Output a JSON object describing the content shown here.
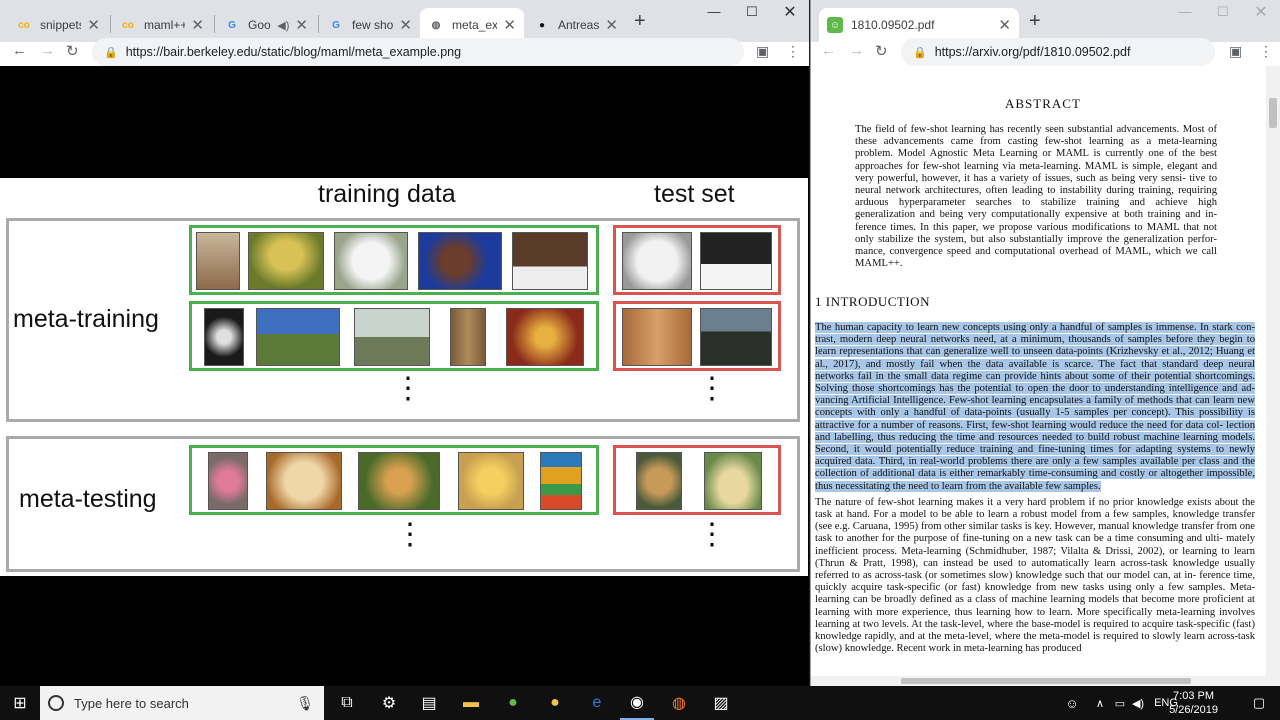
{
  "left_window": {
    "tabs": [
      {
        "title": "snippets.ip",
        "favicon": "colab-icon"
      },
      {
        "title": "maml++.ip",
        "favicon": "colab-icon"
      },
      {
        "title": "Googl",
        "favicon": "google-docs-icon"
      },
      {
        "title": "few shot le",
        "favicon": "google-icon"
      },
      {
        "title": "meta_exam",
        "favicon": "globe-icon"
      },
      {
        "title": "AntreasAnt",
        "favicon": "github-icon"
      }
    ],
    "url": "https://bair.berkeley.edu/static/blog/maml/meta_example.png",
    "figure": {
      "header_train": "training data",
      "header_test": "test set",
      "row1_label": "meta-training",
      "row2_label": "meta-testing",
      "dots": "⋮"
    }
  },
  "right_window": {
    "tab_title": "1810.09502.pdf",
    "url": "https://arxiv.org/pdf/1810.09502.pdf",
    "abstract_title": "ABSTRACT",
    "abstract_lines": [
      "The field of few-shot learning has recently seen substantial advancements. Most",
      "of these advancements came from casting few-shot learning as a meta-learning",
      "problem. Model Agnostic Meta Learning or MAML is currently one of the best",
      "approaches for few-shot learning via meta-learning. MAML is simple, elegant",
      "and very powerful, however, it has a variety of issues, such as being very sensi-",
      "tive to neural network architectures, often leading to instability during training,",
      "requiring arduous hyperparameter searches to stabilize training and achieve high",
      "generalization and being very computationally expensive at both training and in-",
      "ference times. In this paper, we propose various modifications to MAML that not",
      "only stabilize the system, but also substantially improve the generalization perfor-",
      "mance, convergence speed and computational overhead of MAML, which we call",
      "MAML++."
    ],
    "section_title": "1   INTRODUCTION",
    "intro_highlighted_lines": [
      "The human capacity to learn new concepts using only a handful of samples is immense. In stark con-",
      "trast, modern deep neural networks need, at a minimum, thousands of samples before they begin to",
      "learn representations that can generalize well to unseen data-points (Krizhevsky et al., 2012; Huang",
      "et al., 2017), and mostly fail when the data available is scarce. The fact that standard deep neural",
      "networks fail in the small data regime can provide hints about some of their potential shortcomings.",
      "Solving those shortcomings has the potential to open the door to understanding intelligence and ad-",
      "vancing Artificial Intelligence. Few-shot learning encapsulates a family of methods that can learn",
      "new concepts with only a handful of data-points (usually 1-5 samples per concept). This possibility",
      "is attractive for a number of reasons. First, few-shot learning would reduce the need for data col-",
      "lection and labelling, thus reducing the time and resources needed to build robust machine learning",
      "models. Second, it would potentially reduce training and fine-tuning times for adapting systems to",
      "newly acquired data. Third, in real-world problems there are only a few samples available",
      "per class and the collection of additional data is either remarkably time-consuming and costly or",
      "altogether impossible, thus necessitating the need to learn from the available few samples."
    ],
    "intro_lines": [
      "The nature of few-shot learning makes it a very hard problem if no prior knowledge exists about the",
      "task at hand. For a model to be able to learn a robust model from a few samples, knowledge transfer",
      "(see e.g. Caruana, 1995) from other similar tasks is key. However, manual knowledge transfer from",
      "one task to another for the purpose of fine-tuning on a new task can be a time consuming and ulti-",
      "mately inefficient process. Meta-learning (Schmidhuber, 1987; Vilalta & Drissi, 2002), or learning",
      "to learn (Thrun & Pratt, 1998), can instead be used to automatically learn across-task knowledge",
      "usually referred to as across-task (or sometimes slow) knowledge such that our model can, at in-",
      "ference time, quickly acquire task-specific (or fast) knowledge from new tasks using only a few",
      "samples. Meta-learning can be broadly defined as a class of machine learning models that become",
      "more proficient at learning with more experience, thus learning how to learn. More specifically",
      "meta-learning involves learning at two levels. At the task-level, where the base-model is required",
      "to acquire task-specific (fast) knowledge rapidly, and at the meta-level, where the meta-model is",
      "required to slowly learn across-task (slow) knowledge. Recent work in meta-learning has produced"
    ]
  },
  "taskbar": {
    "search_placeholder": "Type here to search",
    "language": "ENG",
    "time": "7:03 PM",
    "date": "5/26/2019"
  }
}
